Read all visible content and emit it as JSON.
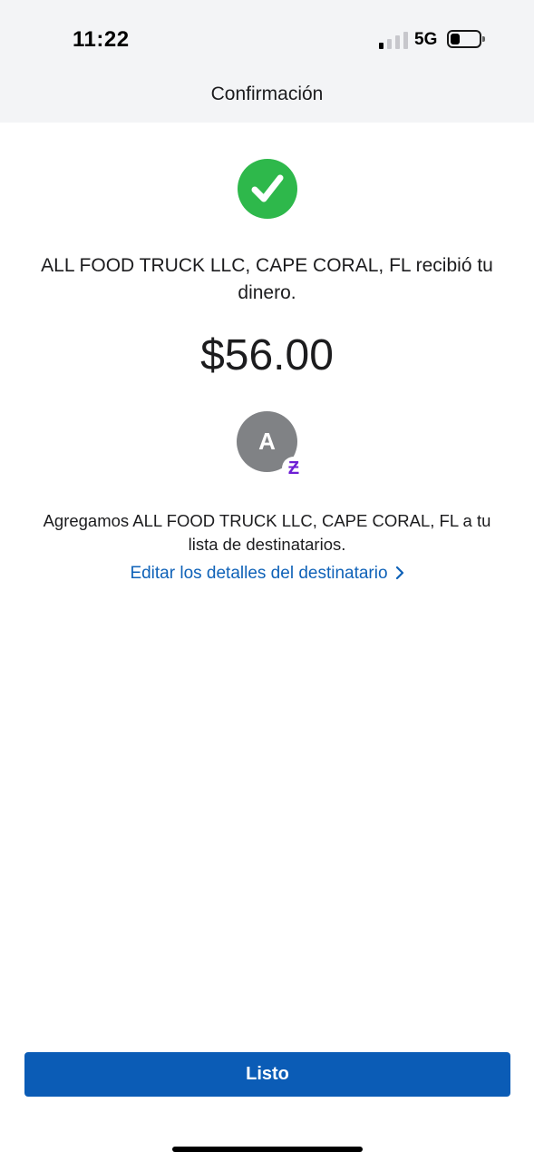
{
  "status_bar": {
    "time": "11:22",
    "network": "5G",
    "signal_bars_active": 1,
    "signal_bars_total": 4,
    "battery_level": 0.25
  },
  "header": {
    "title": "Confirmación"
  },
  "confirmation": {
    "message": "ALL FOOD TRUCK LLC, CAPE CORAL, FL recibió tu dinero.",
    "amount": "$56.00",
    "success_color": "#2eb84b"
  },
  "recipient": {
    "avatar_initial": "A",
    "badge_glyph": "Ƶ",
    "added_message": "Agregamos ALL FOOD TRUCK LLC, CAPE CORAL, FL a tu lista de destinatarios.",
    "edit_link_label": "Editar los detalles del destinatario"
  },
  "actions": {
    "done_label": "Listo",
    "primary_color": "#0b5cb6"
  },
  "icons": {
    "check": "check-icon",
    "chevron": "chevron-right-icon",
    "zelle": "zelle-badge-icon"
  }
}
